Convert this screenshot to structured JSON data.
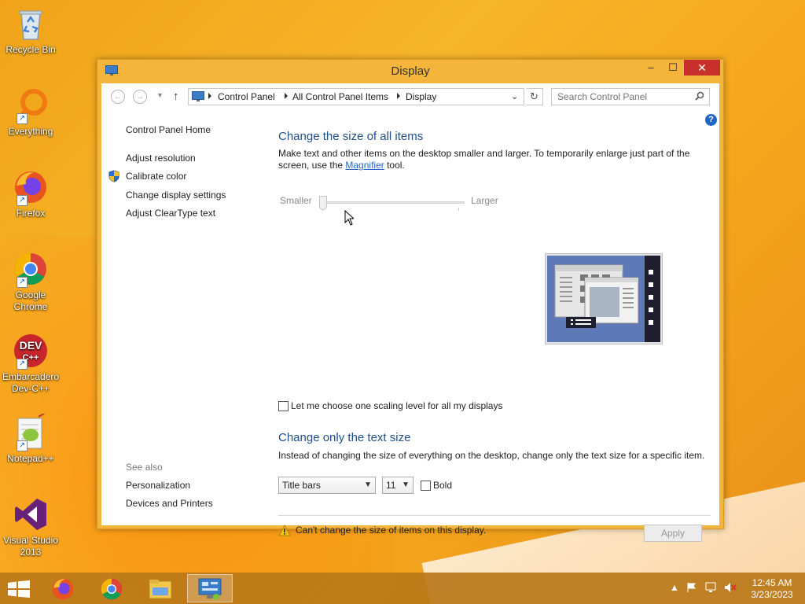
{
  "desktop": {
    "icons": [
      {
        "label": "Recycle Bin",
        "icon": "recycle-bin-icon"
      },
      {
        "label": "Everything",
        "icon": "everything-search-icon"
      },
      {
        "label": "Firefox",
        "icon": "firefox-icon"
      },
      {
        "label": "Google Chrome",
        "icon": "chrome-icon"
      },
      {
        "label": "Embarcadero Dev-C++",
        "icon": "devcpp-icon"
      },
      {
        "label": "Notepad++",
        "icon": "notepadpp-icon"
      },
      {
        "label": "Visual Studio 2013",
        "icon": "visual-studio-icon"
      }
    ],
    "devcpp_badge": "DEV C++"
  },
  "window": {
    "title": "Display",
    "close_glyph": "✕",
    "max_glyph": "☐",
    "min_glyph": "–"
  },
  "navbar": {
    "breadcrumbs": [
      "Control Panel",
      "All Control Panel Items",
      "Display"
    ],
    "search_placeholder": "Search Control Panel"
  },
  "sidebar": {
    "home": "Control Panel Home",
    "links": [
      "Adjust resolution",
      "Calibrate color",
      "Change display settings",
      "Adjust ClearType text"
    ],
    "see_also_heading": "See also",
    "see_also": [
      "Personalization",
      "Devices and Printers"
    ]
  },
  "main": {
    "size_heading": "Change the size of all items",
    "size_desc_before": "Make text and other items on the desktop smaller and larger. To temporarily enlarge just part of the screen, use the ",
    "magnifier_link": "Magnifier",
    "size_desc_after": " tool.",
    "slider_min_label": "Smaller",
    "slider_max_label": "Larger",
    "slider_value_percent": 0,
    "scaling_checkbox_label": "Let me choose one scaling level for all my displays",
    "scaling_checked": false,
    "text_heading": "Change only the text size",
    "text_desc": "Instead of changing the size of everything on the desktop, change only the text size for a specific item.",
    "item_select": "Title bars",
    "size_select": "11",
    "bold_label": "Bold",
    "bold_checked": false,
    "warning_text": "Can't change the size of items on this display.",
    "apply_label": "Apply"
  },
  "taskbar": {
    "apps": [
      "firefox-icon",
      "chrome-icon",
      "file-explorer-icon",
      "control-panel-icon"
    ],
    "time": "12:45 AM",
    "date": "3/23/2023"
  },
  "colors": {
    "accent_blue": "#1e4e8c",
    "link_blue": "#1e66c7",
    "close_red": "#c7302b",
    "window_border": "#f5b43a"
  }
}
